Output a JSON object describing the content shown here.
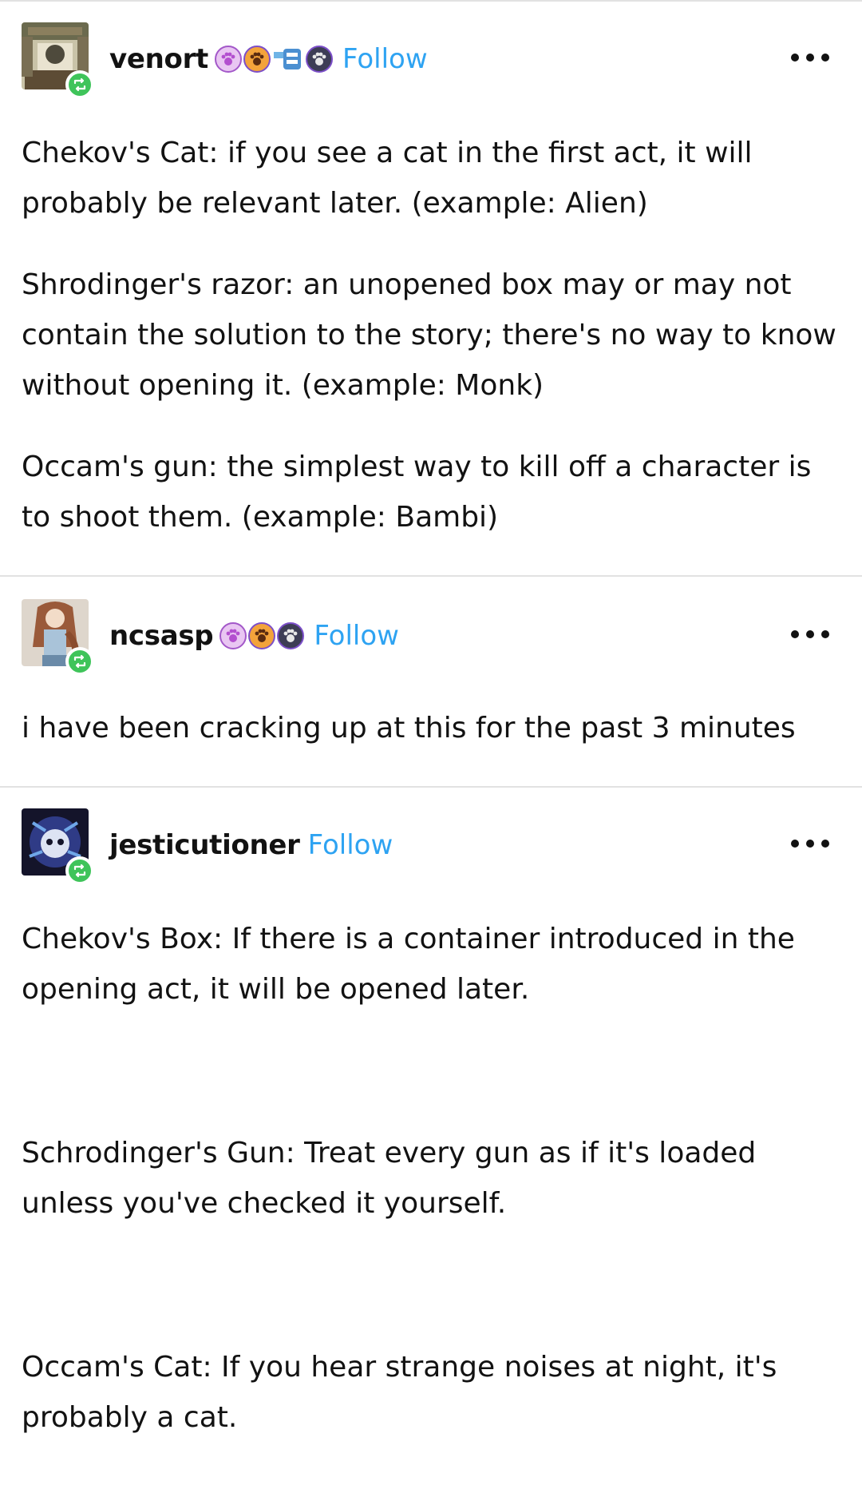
{
  "posts": [
    {
      "username": "venort",
      "follow_label": "Follow",
      "avatar_icon": "avatar-image",
      "badge_icons": [
        "paw-badge-icon",
        "paw-badge-icon",
        "toy-badge-icon",
        "paw-badge-icon"
      ],
      "more_icon": "more-options-icon",
      "paragraphs": [
        "Chekov's Cat: if you see a cat in the first act, it will probably be relevant later. (example: Alien)",
        "Shrodinger's razor: an unopened box may or may not contain the solution to the story; there's no way to know without opening it. (example: Monk)",
        "Occam's gun: the simplest way to kill off a character is to shoot them. (example: Bambi)"
      ]
    },
    {
      "username": "ncsasp",
      "follow_label": "Follow",
      "avatar_icon": "avatar-image",
      "badge_icons": [
        "paw-badge-icon",
        "paw-badge-icon",
        "paw-badge-icon"
      ],
      "more_icon": "more-options-icon",
      "paragraphs": [
        "i have been cracking up at this for the past 3 minutes"
      ]
    },
    {
      "username": "jesticutioner",
      "follow_label": "Follow",
      "avatar_icon": "avatar-image",
      "badge_icons": [],
      "more_icon": "more-options-icon",
      "paragraphs": [
        "Chekov's Box: If there is a container introduced in the opening act, it will be opened later.",
        "Schrodinger's Gun: Treat every gun as if it's loaded unless you've checked it yourself.",
        "Occam's Cat: If you hear strange noises at night, it's probably a cat."
      ]
    }
  ],
  "colors": {
    "follow": "#2ea3f2",
    "reblog_badge": "#3fc45a",
    "divider": "#e2e2e2",
    "text": "#121212"
  }
}
